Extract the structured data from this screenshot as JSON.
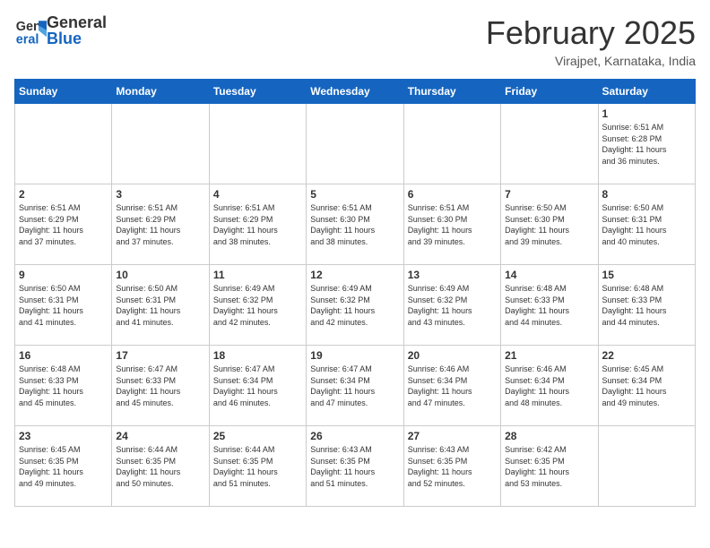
{
  "header": {
    "logo_general": "General",
    "logo_blue": "Blue",
    "month_title": "February 2025",
    "location": "Virajpet, Karnataka, India"
  },
  "weekdays": [
    "Sunday",
    "Monday",
    "Tuesday",
    "Wednesday",
    "Thursday",
    "Friday",
    "Saturday"
  ],
  "weeks": [
    [
      {
        "day": "",
        "info": ""
      },
      {
        "day": "",
        "info": ""
      },
      {
        "day": "",
        "info": ""
      },
      {
        "day": "",
        "info": ""
      },
      {
        "day": "",
        "info": ""
      },
      {
        "day": "",
        "info": ""
      },
      {
        "day": "1",
        "info": "Sunrise: 6:51 AM\nSunset: 6:28 PM\nDaylight: 11 hours\nand 36 minutes."
      }
    ],
    [
      {
        "day": "2",
        "info": "Sunrise: 6:51 AM\nSunset: 6:29 PM\nDaylight: 11 hours\nand 37 minutes."
      },
      {
        "day": "3",
        "info": "Sunrise: 6:51 AM\nSunset: 6:29 PM\nDaylight: 11 hours\nand 37 minutes."
      },
      {
        "day": "4",
        "info": "Sunrise: 6:51 AM\nSunset: 6:29 PM\nDaylight: 11 hours\nand 38 minutes."
      },
      {
        "day": "5",
        "info": "Sunrise: 6:51 AM\nSunset: 6:30 PM\nDaylight: 11 hours\nand 38 minutes."
      },
      {
        "day": "6",
        "info": "Sunrise: 6:51 AM\nSunset: 6:30 PM\nDaylight: 11 hours\nand 39 minutes."
      },
      {
        "day": "7",
        "info": "Sunrise: 6:50 AM\nSunset: 6:30 PM\nDaylight: 11 hours\nand 39 minutes."
      },
      {
        "day": "8",
        "info": "Sunrise: 6:50 AM\nSunset: 6:31 PM\nDaylight: 11 hours\nand 40 minutes."
      }
    ],
    [
      {
        "day": "9",
        "info": "Sunrise: 6:50 AM\nSunset: 6:31 PM\nDaylight: 11 hours\nand 41 minutes."
      },
      {
        "day": "10",
        "info": "Sunrise: 6:50 AM\nSunset: 6:31 PM\nDaylight: 11 hours\nand 41 minutes."
      },
      {
        "day": "11",
        "info": "Sunrise: 6:49 AM\nSunset: 6:32 PM\nDaylight: 11 hours\nand 42 minutes."
      },
      {
        "day": "12",
        "info": "Sunrise: 6:49 AM\nSunset: 6:32 PM\nDaylight: 11 hours\nand 42 minutes."
      },
      {
        "day": "13",
        "info": "Sunrise: 6:49 AM\nSunset: 6:32 PM\nDaylight: 11 hours\nand 43 minutes."
      },
      {
        "day": "14",
        "info": "Sunrise: 6:48 AM\nSunset: 6:33 PM\nDaylight: 11 hours\nand 44 minutes."
      },
      {
        "day": "15",
        "info": "Sunrise: 6:48 AM\nSunset: 6:33 PM\nDaylight: 11 hours\nand 44 minutes."
      }
    ],
    [
      {
        "day": "16",
        "info": "Sunrise: 6:48 AM\nSunset: 6:33 PM\nDaylight: 11 hours\nand 45 minutes."
      },
      {
        "day": "17",
        "info": "Sunrise: 6:47 AM\nSunset: 6:33 PM\nDaylight: 11 hours\nand 45 minutes."
      },
      {
        "day": "18",
        "info": "Sunrise: 6:47 AM\nSunset: 6:34 PM\nDaylight: 11 hours\nand 46 minutes."
      },
      {
        "day": "19",
        "info": "Sunrise: 6:47 AM\nSunset: 6:34 PM\nDaylight: 11 hours\nand 47 minutes."
      },
      {
        "day": "20",
        "info": "Sunrise: 6:46 AM\nSunset: 6:34 PM\nDaylight: 11 hours\nand 47 minutes."
      },
      {
        "day": "21",
        "info": "Sunrise: 6:46 AM\nSunset: 6:34 PM\nDaylight: 11 hours\nand 48 minutes."
      },
      {
        "day": "22",
        "info": "Sunrise: 6:45 AM\nSunset: 6:34 PM\nDaylight: 11 hours\nand 49 minutes."
      }
    ],
    [
      {
        "day": "23",
        "info": "Sunrise: 6:45 AM\nSunset: 6:35 PM\nDaylight: 11 hours\nand 49 minutes."
      },
      {
        "day": "24",
        "info": "Sunrise: 6:44 AM\nSunset: 6:35 PM\nDaylight: 11 hours\nand 50 minutes."
      },
      {
        "day": "25",
        "info": "Sunrise: 6:44 AM\nSunset: 6:35 PM\nDaylight: 11 hours\nand 51 minutes."
      },
      {
        "day": "26",
        "info": "Sunrise: 6:43 AM\nSunset: 6:35 PM\nDaylight: 11 hours\nand 51 minutes."
      },
      {
        "day": "27",
        "info": "Sunrise: 6:43 AM\nSunset: 6:35 PM\nDaylight: 11 hours\nand 52 minutes."
      },
      {
        "day": "28",
        "info": "Sunrise: 6:42 AM\nSunset: 6:35 PM\nDaylight: 11 hours\nand 53 minutes."
      },
      {
        "day": "",
        "info": ""
      }
    ]
  ]
}
